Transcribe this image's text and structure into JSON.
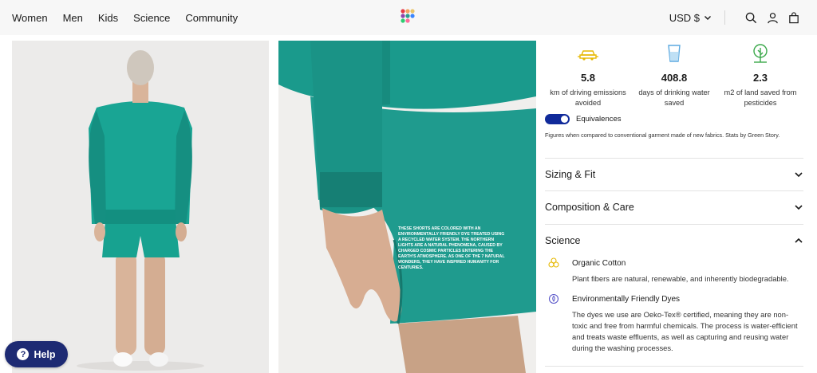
{
  "header": {
    "nav": [
      "Women",
      "Men",
      "Kids",
      "Science",
      "Community"
    ],
    "currency": "USD $"
  },
  "images": {
    "photo_text": "THESE SHORTS ARE COLORED WITH AN ENVIRONMENTALLY FRIENDLY DYE TREATED USING A RECYCLED WATER SYSTEM. THE NORTHERN LIGHTS ARE A NATURAL PHENOMENA, CAUSED BY CHARGED COSMIC PARTICLES ENTERING THE EARTH'S ATMOSPHERE. AS ONE OF THE 7 NATURAL WONDERS, THEY HAVE INSPIRED HUMANITY FOR CENTURIES."
  },
  "impact": [
    {
      "icon": "car-icon",
      "value": "5.8",
      "label": "km of driving emissions avoided"
    },
    {
      "icon": "water-glass-icon",
      "value": "408.8",
      "label": "days of drinking water saved"
    },
    {
      "icon": "tree-icon",
      "value": "2.3",
      "label": "m2 of land saved from pesticides"
    }
  ],
  "equivalences": {
    "label": "Equivalences",
    "on": true,
    "note": "Figures when compared to conventional garment made of new fabrics. Stats by Green Story."
  },
  "accordions": [
    {
      "title": "Sizing & Fit",
      "open": false
    },
    {
      "title": "Composition & Care",
      "open": false
    },
    {
      "title": "Science",
      "open": true
    }
  ],
  "science": [
    {
      "icon": "cotton-icon",
      "title": "Organic Cotton",
      "description": "Plant fibers are natural, renewable, and inherently biodegradable."
    },
    {
      "icon": "dye-icon",
      "title": "Environmentally Friendly Dyes",
      "description": "The dyes we use are Oeko-Tex® certified, meaning they are non-toxic and free from harmful chemicals. The process is water-efficient and treats waste effluents, as well as capturing and reusing water during the washing processes."
    }
  ],
  "help": {
    "label": "Help",
    "icon": "question-icon"
  },
  "colors": {
    "accent_blue": "#102a9a",
    "help_bg": "#1d2a73",
    "garment_green": "#1f9b8e"
  }
}
